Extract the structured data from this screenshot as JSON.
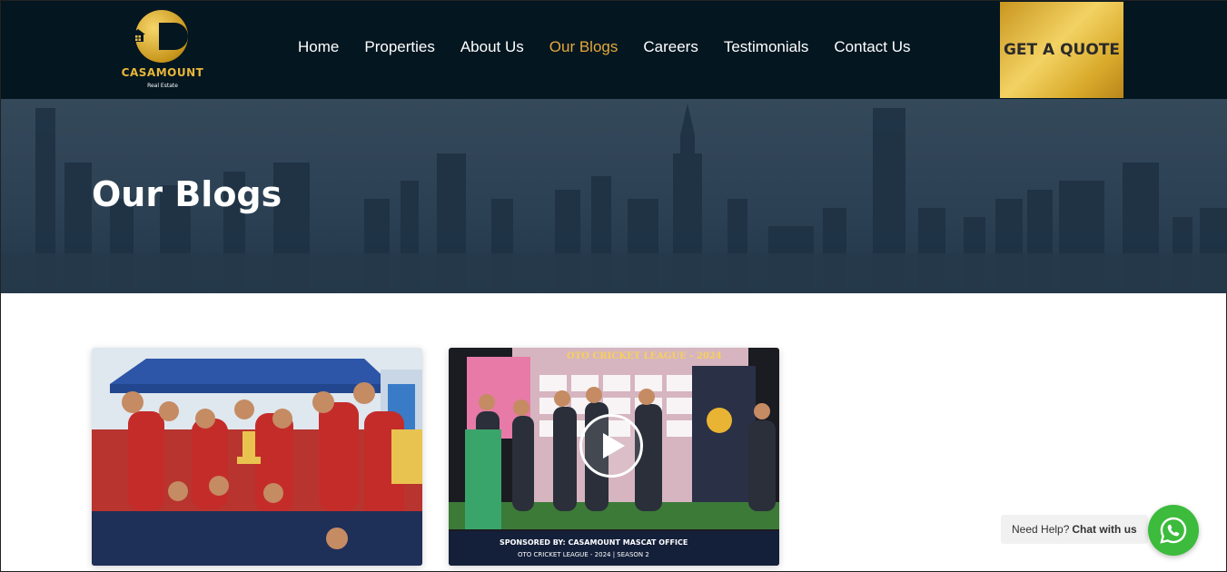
{
  "brand": {
    "name": "CASAMOUNT",
    "tagline": "Real Estate",
    "accent": "#e3a93a"
  },
  "nav": {
    "items": [
      {
        "label": "Home",
        "active": false
      },
      {
        "label": "Properties",
        "active": false
      },
      {
        "label": "About Us",
        "active": false
      },
      {
        "label": "Our Blogs",
        "active": true
      },
      {
        "label": "Careers",
        "active": false
      },
      {
        "label": "Testimonials",
        "active": false
      },
      {
        "label": "Contact Us",
        "active": false
      }
    ],
    "cta_label": "GET A QUOTE"
  },
  "hero": {
    "title": "Our Blogs"
  },
  "blogs": [
    {
      "media": "photo",
      "alt_icon": "image"
    },
    {
      "media": "video",
      "poster_title": "OTO CRICKET LEAGUE - 2024",
      "sponsor_line": "SPONSORED BY: CASAMOUNT MASCAT OFFICE",
      "season_line": "OTO CRICKET LEAGUE - 2024 | SEASON 2"
    }
  ],
  "chat": {
    "prefix": "Need Help?",
    "action": "Chat with us",
    "icon": "whatsapp-icon",
    "color": "#3cbb3c"
  }
}
